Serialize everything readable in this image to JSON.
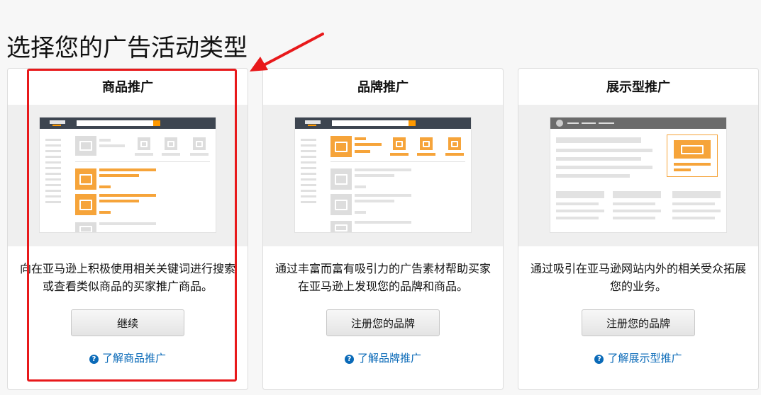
{
  "page": {
    "title": "选择您的广告活动类型"
  },
  "cards": [
    {
      "title": "商品推广",
      "description": "向在亚马逊上积极使用相关关键词进行搜索或查看类似商品的买家推广商品。",
      "button": "继续",
      "learn_more": "了解商品推广"
    },
    {
      "title": "品牌推广",
      "description": "通过丰富而富有吸引力的广告素材帮助买家在亚马逊上发现您的品牌和商品。",
      "button": "注册您的品牌",
      "learn_more": "了解品牌推广"
    },
    {
      "title": "展示型推广",
      "description": "通过吸引在亚马逊网站内外的相关受众拓展您的业务。",
      "button": "注册您的品牌",
      "learn_more": "了解展示型推广"
    }
  ],
  "icons": {
    "help": "help-circle-icon",
    "help_glyph": "?"
  },
  "colors": {
    "accent": "#f6a43a",
    "link": "#0a6ab8",
    "annotation": "#e8191b"
  }
}
